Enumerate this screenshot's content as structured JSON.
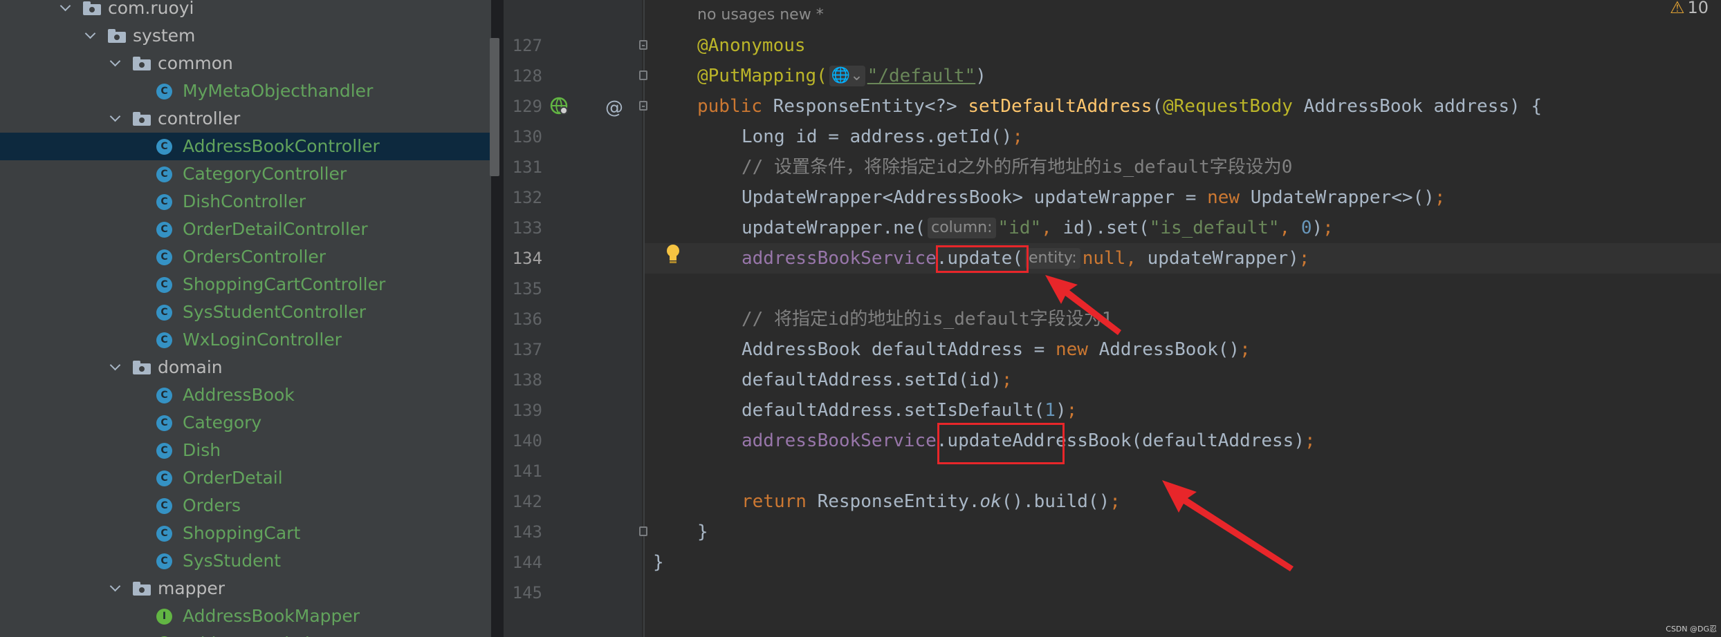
{
  "tree": {
    "items": [
      {
        "label": "com.ruoyi",
        "type": "folder"
      },
      {
        "label": "system",
        "type": "folder"
      },
      {
        "label": "common",
        "type": "folder"
      },
      {
        "label": "MyMetaObjecthandler",
        "type": "class"
      },
      {
        "label": "controller",
        "type": "folder"
      },
      {
        "label": "AddressBookController",
        "type": "class",
        "selected": true
      },
      {
        "label": "CategoryController",
        "type": "class"
      },
      {
        "label": "DishController",
        "type": "class"
      },
      {
        "label": "OrderDetailController",
        "type": "class"
      },
      {
        "label": "OrdersController",
        "type": "class"
      },
      {
        "label": "ShoppingCartController",
        "type": "class"
      },
      {
        "label": "SysStudentController",
        "type": "class"
      },
      {
        "label": "WxLoginController",
        "type": "class"
      },
      {
        "label": "domain",
        "type": "folder"
      },
      {
        "label": "AddressBook",
        "type": "class"
      },
      {
        "label": "Category",
        "type": "class"
      },
      {
        "label": "Dish",
        "type": "class"
      },
      {
        "label": "OrderDetail",
        "type": "class"
      },
      {
        "label": "Orders",
        "type": "class"
      },
      {
        "label": "ShoppingCart",
        "type": "class"
      },
      {
        "label": "SysStudent",
        "type": "class"
      },
      {
        "label": "mapper",
        "type": "folder"
      },
      {
        "label": "AddressBookMapper",
        "type": "interface"
      },
      {
        "label": "AddressBookPlusMapper",
        "type": "interface"
      }
    ],
    "class_badge": "C",
    "interface_badge": "I"
  },
  "editor": {
    "usages": "no usages   new *",
    "warnings_count": "10",
    "line_numbers": [
      "127",
      "128",
      "129",
      "130",
      "131",
      "132",
      "133",
      "134",
      "135",
      "136",
      "137",
      "138",
      "139",
      "140",
      "141",
      "142",
      "143",
      "144",
      "145"
    ],
    "current_line": "134",
    "gutter_at": "@",
    "code": {
      "l127": "@Anonymous",
      "l128_ann": "@PutMapping(",
      "l128_path": "\"/default\"",
      "l128_end": ")",
      "l129_kw": "public",
      "l129_type": " ResponseEntity<?> ",
      "l129_fn": "setDefaultAddress",
      "l129_open": "(",
      "l129_ann": "@RequestBody",
      "l129_rest": " AddressBook address) {",
      "l130": "Long id = address.getId()",
      "l131": "// 设置条件，将除指定id之外的所有地址的is_default字段设为0",
      "l132_a": "UpdateWrapper<AddressBook> updateWrapper = ",
      "l132_new": "new",
      "l132_b": " UpdateWrapper<>()",
      "l133_a": "updateWrapper.ne(",
      "l133_hint": "column:",
      "l133_s1": "\"id\"",
      "l133_b": " id).set(",
      "l133_s2": "\"is_default\"",
      "l133_n": "0",
      "l133_c": ")",
      "l134_field": "addressBookService",
      "l134_call": ".update(",
      "l134_hint": "entity:",
      "l134_null": "null",
      "l134_rest": " updateWrapper)",
      "l136": "// 将指定id的地址的is_default字段设为1",
      "l137_a": "AddressBook defaultAddress = ",
      "l137_new": "new",
      "l137_b": " AddressBook()",
      "l138": "defaultAddress.setId(id)",
      "l139_a": "defaultAddress.setIsDefault(",
      "l139_n": "1",
      "l139_b": ")",
      "l140_field": "addressBookService",
      "l140_call": ".updateAddressBook",
      "l140_rest": "(defaultAddress)",
      "l142_kw": "return",
      "l142_a": " ResponseEntity.",
      "l142_ok": "ok",
      "l142_b": "().build()",
      "l143": "}",
      "l144": "}",
      "semi": ";",
      "comma": ","
    }
  },
  "watermark": "CSDN @DG忍",
  "colors": {
    "highlight_box": "#e8262a",
    "arrow": "#e8262a"
  }
}
